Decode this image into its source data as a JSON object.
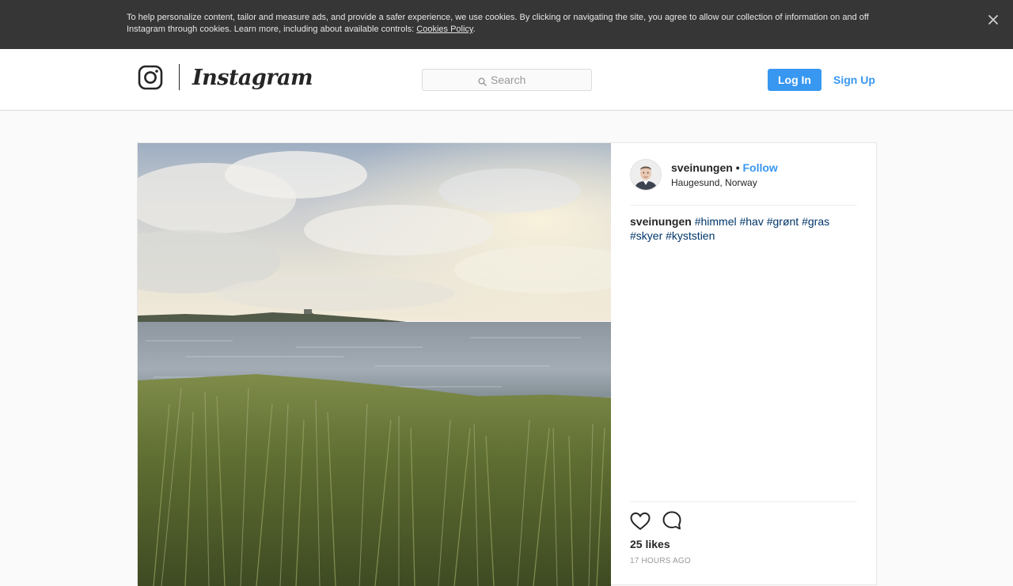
{
  "cookie_banner": {
    "text": "To help personalize content, tailor and measure ads, and provide a safer experience, we use cookies. By clicking or navigating the site, you agree to allow our collection of information on and off Instagram through cookies. Learn more, including about available controls: ",
    "link_label": "Cookies Policy",
    "suffix": ".",
    "close_icon": "close-icon"
  },
  "header": {
    "logo_icon": "instagram-camera-icon",
    "wordmark": "Instagram",
    "search": {
      "placeholder": "Search",
      "value": "",
      "icon": "search-icon"
    },
    "login_label": "Log In",
    "signup_label": "Sign Up"
  },
  "post": {
    "author": "sveinungen",
    "separator": "•",
    "follow_label": "Follow",
    "location": "Haugesund, Norway",
    "caption_user": "sveinungen",
    "hashtags": [
      "#himmel",
      "#hav",
      "#grønt",
      "#gras",
      "#skyer",
      "#kyststien"
    ],
    "likes": "25 likes",
    "timestamp": "17 HOURS AGO",
    "like_icon": "heart-icon",
    "comment_icon": "comment-icon"
  },
  "colors": {
    "accent": "#3897f0",
    "hashtag": "#003569",
    "banner_bg": "#363636",
    "border": "#dbdbdb"
  }
}
